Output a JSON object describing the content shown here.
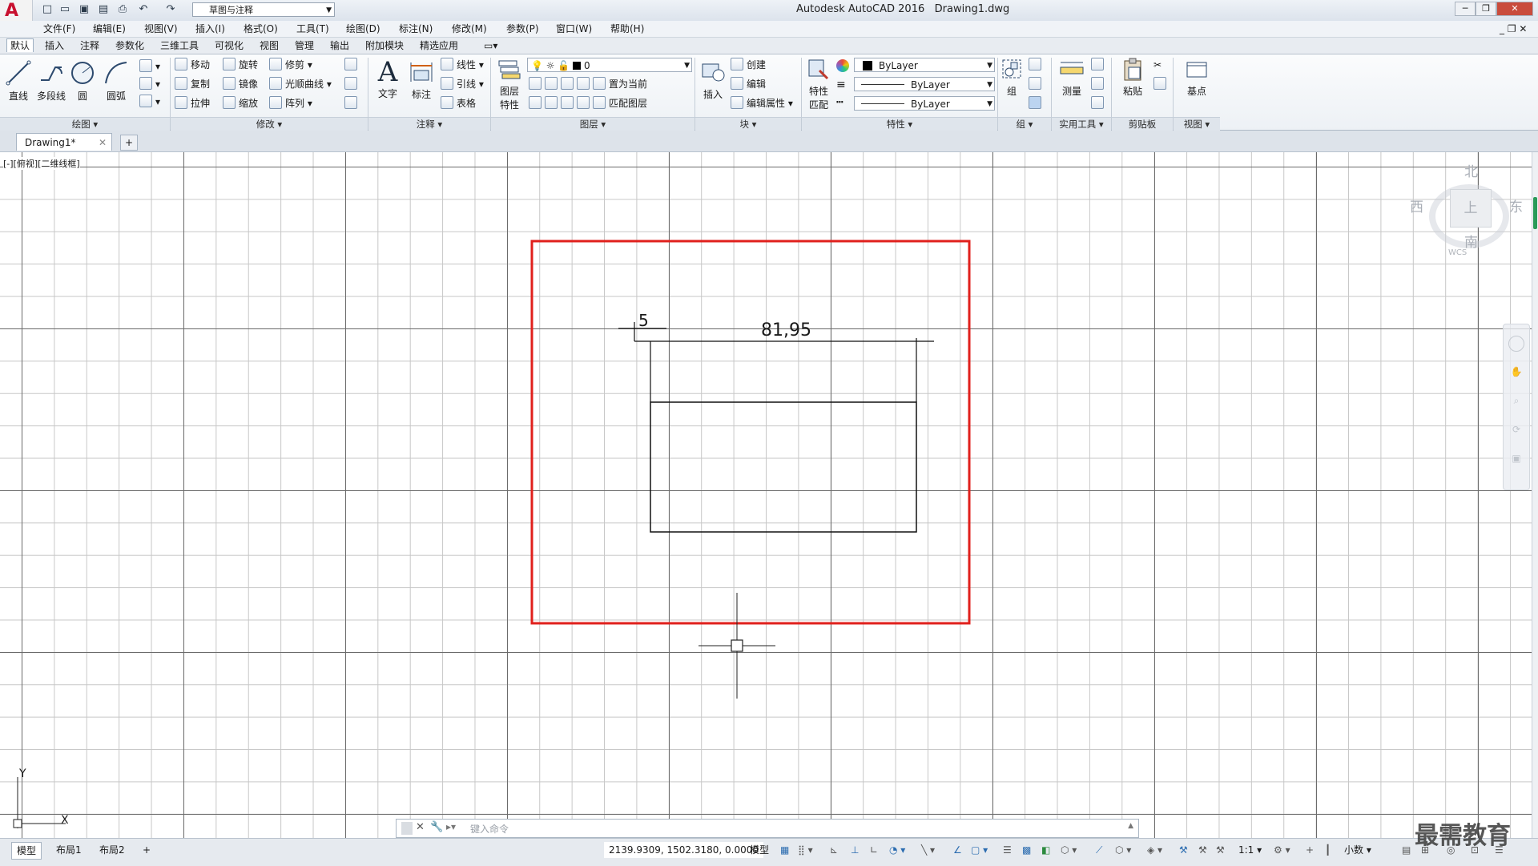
{
  "titlebar": {
    "app_title": "Autodesk AutoCAD 2016",
    "file_name": "Drawing1.dwg",
    "workspace": "草图与注释"
  },
  "menu": [
    "文件(F)",
    "编辑(E)",
    "视图(V)",
    "插入(I)",
    "格式(O)",
    "工具(T)",
    "绘图(D)",
    "标注(N)",
    "修改(M)",
    "参数(P)",
    "窗口(W)",
    "帮助(H)"
  ],
  "ribbon_tabs": [
    "默认",
    "插入",
    "注释",
    "参数化",
    "三维工具",
    "可视化",
    "视图",
    "管理",
    "输出",
    "附加模块",
    "精选应用"
  ],
  "ribbon": {
    "draw": {
      "line": "直线",
      "polyline": "多段线",
      "circle": "圆",
      "arc": "圆弧",
      "title": "绘图"
    },
    "modify": {
      "move": "移动",
      "rotate": "旋转",
      "trim": "修剪",
      "copy": "复制",
      "mirror": "镜像",
      "spline": "光顺曲线",
      "stretch": "拉伸",
      "scale": "缩放",
      "array": "阵列",
      "title": "修改"
    },
    "annotation": {
      "text": "文字",
      "dimension": "标注",
      "linear": "线性",
      "leader": "引线",
      "table": "表格",
      "title": "注释"
    },
    "layers": {
      "layer_props_1": "图层",
      "layer_props_2": "特性",
      "current_layer": "0",
      "set_current": "置为当前",
      "match_layer": "匹配图层",
      "title": "图层"
    },
    "block": {
      "insert": "插入",
      "create": "创建",
      "edit": "编辑",
      "edit_attr": "编辑属性",
      "title": "块"
    },
    "properties": {
      "match_1": "特性",
      "match_2": "匹配",
      "color": "ByLayer",
      "linetype": "ByLayer",
      "lineweight": "ByLayer",
      "title": "特性"
    },
    "groups": {
      "group": "组",
      "title": "组"
    },
    "utilities": {
      "measure": "测量",
      "title": "实用工具"
    },
    "clipboard": {
      "paste": "粘贴",
      "title": "剪贴板"
    },
    "view": {
      "base": "基点",
      "title": "视图"
    }
  },
  "doc_tab": "Drawing1*",
  "viewport_label": "[-][俯视][二维线框]",
  "viewcube": {
    "north": "北",
    "south": "南",
    "east": "东",
    "west": "西",
    "top": "上",
    "wcs": "WCS"
  },
  "drawing": {
    "dim_small": "5",
    "dim_large": "81,95"
  },
  "ucs": {
    "x": "X",
    "y": "Y"
  },
  "command": {
    "placeholder": "键入命令"
  },
  "status": {
    "coords": "2139.9309, 1502.3180, 0.0000",
    "model": "模型",
    "scale": "1:1",
    "units": "小数",
    "tabs": [
      "模型",
      "布局1",
      "布局2"
    ]
  },
  "watermark": "最需教育"
}
